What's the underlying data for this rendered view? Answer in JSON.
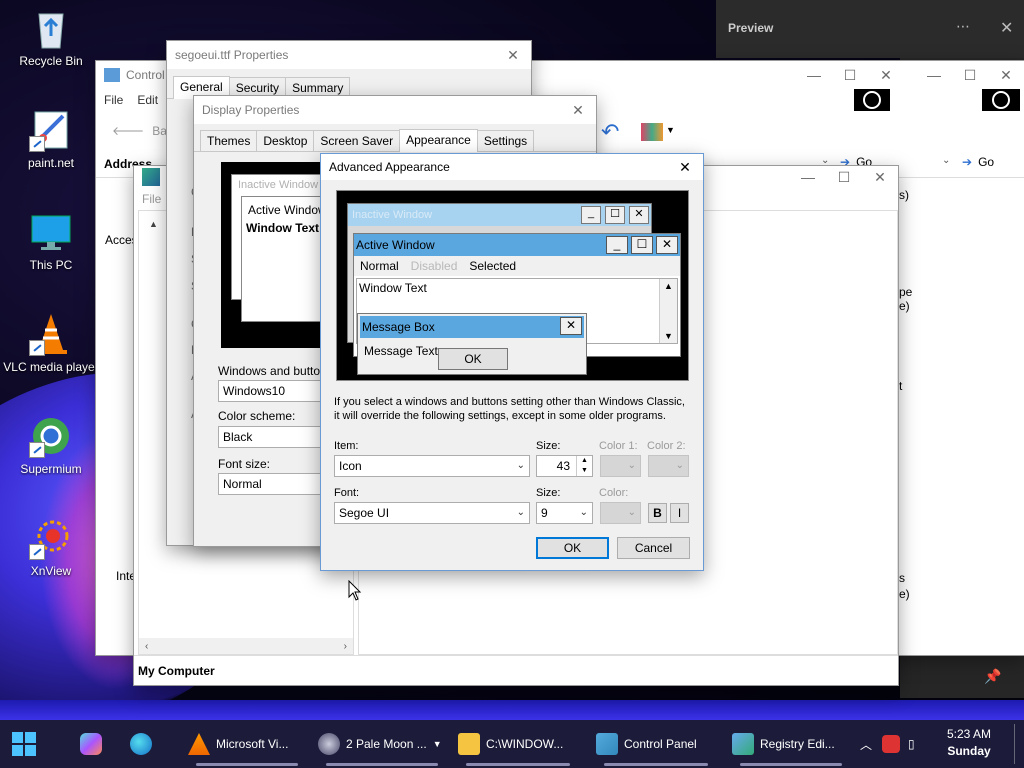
{
  "desktop": {
    "icons": [
      {
        "label": "Recycle Bin"
      },
      {
        "label": "paint.net"
      },
      {
        "label": "This PC"
      },
      {
        "label": "VLC media player"
      },
      {
        "label": "Supermium"
      },
      {
        "label": "XnView"
      }
    ]
  },
  "preview_panel": {
    "title": "Preview"
  },
  "control_panel_window": {
    "title": "Control Panel",
    "menu": [
      "File",
      "Edit"
    ],
    "back_label": "Back",
    "address_label": "Address",
    "go_label": "Go",
    "left_text_1": "Acces",
    "left_text_2": "Inte",
    "right_frags": [
      "s)",
      "pe",
      "e)",
      "t",
      "s",
      "e)"
    ]
  },
  "registry_window": {
    "menu_file": "File",
    "status": "My Computer"
  },
  "font_properties": {
    "title": "segoeui.ttf Properties",
    "tabs": [
      "General",
      "Security",
      "Summary"
    ],
    "left_letters": [
      "C",
      "L",
      "S",
      "S",
      "C",
      "M",
      "A",
      "A"
    ]
  },
  "display_properties": {
    "title": "Display Properties",
    "tabs": [
      "Themes",
      "Desktop",
      "Screen Saver",
      "Appearance",
      "Settings"
    ],
    "preview": {
      "inactive": "Inactive Window",
      "active": "Active Window",
      "window_text": "Window Text"
    },
    "windows_buttons_label": "Windows and buttons:",
    "windows_buttons_value": "Windows10",
    "color_scheme_label": "Color scheme:",
    "color_scheme_value": "Black",
    "font_size_label": "Font size:",
    "font_size_value": "Normal"
  },
  "advanced_appearance": {
    "title": "Advanced Appearance",
    "preview": {
      "inactive_title": "Inactive Window",
      "active_title": "Active Window",
      "menu_normal": "Normal",
      "menu_disabled": "Disabled",
      "menu_selected": "Selected",
      "window_text": "Window Text",
      "msgbox_title": "Message Box",
      "msgbox_text": "Message Text",
      "msgbox_ok": "OK"
    },
    "info_text_1": "If you select a windows and buttons setting other than Windows Classic,",
    "info_text_2": "it will override the following settings, except in some older programs.",
    "item_label": "Item:",
    "item_value": "Icon",
    "size_label": "Size:",
    "size_value": "43",
    "color1_label": "Color 1:",
    "color2_label": "Color 2:",
    "font_label": "Font:",
    "font_value": "Segoe UI",
    "font_size_label": "Size:",
    "font_size_value": "9",
    "color_label": "Color:",
    "bold_label": "B",
    "italic_label": "I",
    "ok_label": "OK",
    "cancel_label": "Cancel"
  },
  "taskbar": {
    "items": [
      {
        "label": "Microsoft Vi..."
      },
      {
        "label": "2 Pale Moon ..."
      },
      {
        "label": "C:\\WINDOW..."
      },
      {
        "label": "Control Panel"
      },
      {
        "label": "Registry Edi..."
      }
    ],
    "time": "5:23 AM",
    "day": "Sunday"
  },
  "colors": {
    "accent": "#0078d7",
    "active_title": "#5aa7e0",
    "inactive_title": "#a8d3f0",
    "taskbar": "#1c1c3a"
  }
}
